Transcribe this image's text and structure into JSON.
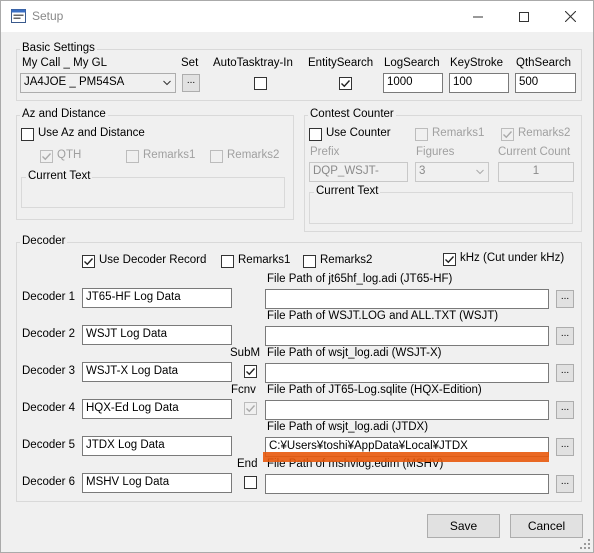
{
  "window": {
    "title": "Setup"
  },
  "basic": {
    "group_label": "Basic Settings",
    "my_call_label": "My Call _ My GL",
    "my_call_value": "JA4JOE _ PM54SA",
    "set_label": "Set",
    "set_button": "...",
    "autotasktray_label": "AutoTasktray-In",
    "entity_search_label": "EntitySearch",
    "log_search_label": "LogSearch",
    "log_search_value": "1000",
    "keystroke_label": "KeyStroke",
    "keystroke_value": "100",
    "qth_search_label": "QthSearch",
    "qth_search_value": "500"
  },
  "az": {
    "group_label": "Az and Distance",
    "use_label": "Use Az and Distance",
    "qth_label": "QTH",
    "remarks1_label": "Remarks1",
    "remarks2_label": "Remarks2",
    "current_text_label": "Current Text"
  },
  "contest": {
    "group_label": "Contest Counter",
    "use_label": "Use Counter",
    "remarks1_label": "Remarks1",
    "remarks2_label": "Remarks2",
    "prefix_label": "Prefix",
    "prefix_value": "DQP_WSJT-",
    "figures_label": "Figures",
    "figures_value": "3",
    "current_count_label": "Current Count",
    "current_count_value": "1",
    "current_text_label": "Current Text"
  },
  "decoder": {
    "group_label": "Decoder",
    "use_record_label": "Use Decoder Record",
    "remarks1_label": "Remarks1",
    "remarks2_label": "Remarks2",
    "khz_label": "kHz (Cut under kHz)",
    "rows": [
      {
        "label": "Decoder 1",
        "name": "JT65-HF Log Data",
        "path_label": "File Path of jt65hf_log.adi (JT65-HF)",
        "path_value": "",
        "browse": "...",
        "opt_label": ""
      },
      {
        "label": "Decoder 2",
        "name": "WSJT Log Data",
        "path_label": "File Path of WSJT.LOG and ALL.TXT (WSJT)",
        "path_value": "",
        "browse": "...",
        "opt_label": ""
      },
      {
        "label": "Decoder 3",
        "name": "WSJT-X Log Data",
        "path_label": "File Path of wsjt_log.adi (WSJT-X)",
        "path_value": "",
        "browse": "...",
        "opt_label": "SubM"
      },
      {
        "label": "Decoder 4",
        "name": "HQX-Ed Log Data",
        "path_label": "File Path of JT65-Log.sqlite (HQX-Edition)",
        "path_value": "",
        "browse": "...",
        "opt_label": "Fcnv"
      },
      {
        "label": "Decoder 5",
        "name": "JTDX Log Data",
        "path_label": "File Path of wsjt_log.adi (JTDX)",
        "path_value": "C:¥Users¥toshi¥AppData¥Local¥JTDX",
        "browse": "...",
        "opt_label": ""
      },
      {
        "label": "Decoder 6",
        "name": "MSHV Log Data",
        "path_label": "File Path of mshvlog.edim (MSHV)",
        "path_value": "",
        "browse": "...",
        "opt_label": "End"
      }
    ]
  },
  "buttons": {
    "save": "Save",
    "cancel": "Cancel"
  },
  "colors": {
    "highlight": "#e8590c"
  },
  "icons": [
    "app-icon",
    "minimize-icon",
    "maximize-icon",
    "close-icon",
    "checkmark-icon",
    "chevron-down-icon",
    "resize-grip-icon"
  ]
}
